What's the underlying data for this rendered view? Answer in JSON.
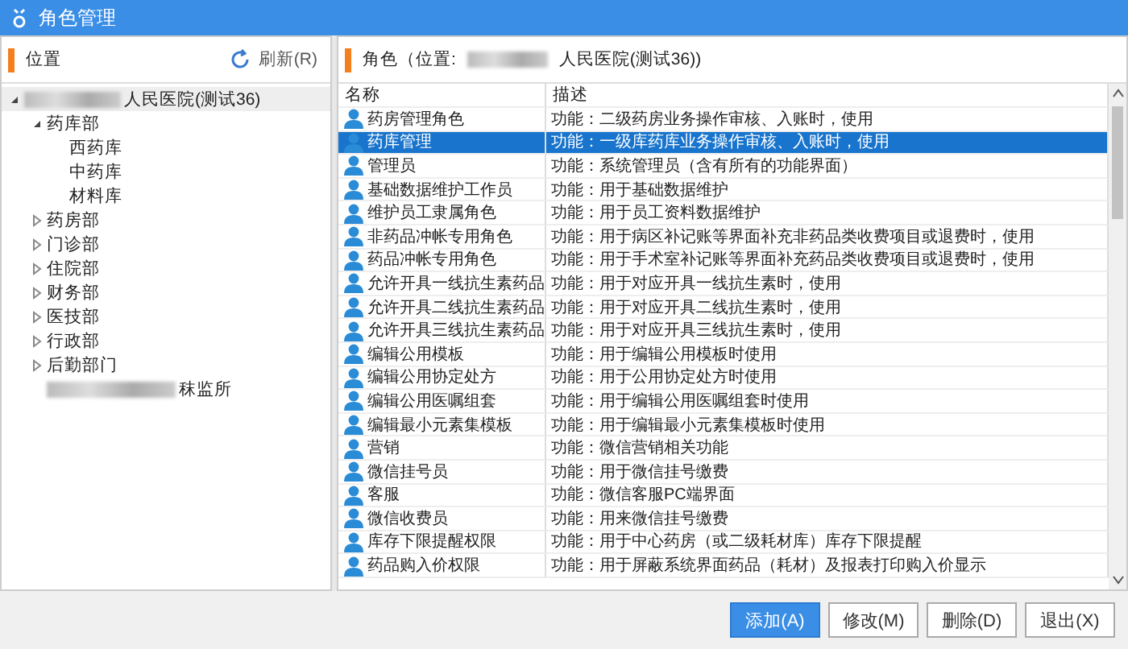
{
  "window": {
    "title": "角色管理"
  },
  "location_panel": {
    "title": "位置",
    "refresh_button": "刷新(R)",
    "tree": [
      {
        "label": "人民医院(测试36)",
        "redacted": true,
        "expanded": true,
        "children": [
          {
            "label": "药库部",
            "expanded": true,
            "children": [
              {
                "label": "西药库"
              },
              {
                "label": "中药库"
              },
              {
                "label": "材料库"
              }
            ]
          },
          {
            "label": "药房部",
            "expanded": false
          },
          {
            "label": "门诊部",
            "expanded": false
          },
          {
            "label": "住院部",
            "expanded": false
          },
          {
            "label": "财务部",
            "expanded": false
          },
          {
            "label": "医技部",
            "expanded": false
          },
          {
            "label": "行政部",
            "expanded": false
          },
          {
            "label": "后勤部门",
            "expanded": false
          },
          {
            "label": "秣监所",
            "redacted": true
          }
        ]
      }
    ]
  },
  "roles_panel": {
    "title_prefix": "角色（位置:",
    "title_suffix": "人民医院(测试36))",
    "table": {
      "columns": [
        "名称",
        "描述"
      ],
      "rows": [
        {
          "name": "药房管理角色",
          "description": "功能：二级药房业务操作审核、入账时，使用",
          "selected": false
        },
        {
          "name": "药库管理",
          "description": "功能：一级库药库业务操作审核、入账时，使用",
          "selected": true
        },
        {
          "name": "管理员",
          "description": "功能：系统管理员（含有所有的功能界面）",
          "selected": false
        },
        {
          "name": "基础数据维护工作员",
          "description": "功能：用于基础数据维护",
          "selected": false
        },
        {
          "name": "维护员工隶属角色",
          "description": "功能：用于员工资料数据维护",
          "selected": false
        },
        {
          "name": "非药品冲帐专用角色",
          "description": "功能：用于病区补记账等界面补充非药品类收费项目或退费时，使用",
          "selected": false
        },
        {
          "name": "药品冲帐专用角色",
          "description": "功能：用于手术室补记账等界面补充药品类收费项目或退费时，使用",
          "selected": false
        },
        {
          "name": "允许开具一线抗生素药品",
          "description": "功能：用于对应开具一线抗生素时，使用",
          "selected": false
        },
        {
          "name": "允许开具二线抗生素药品",
          "description": "功能：用于对应开具二线抗生素时，使用",
          "selected": false
        },
        {
          "name": "允许开具三线抗生素药品",
          "description": "功能：用于对应开具三线抗生素时，使用",
          "selected": false
        },
        {
          "name": "编辑公用模板",
          "description": "功能：用于编辑公用模板时使用",
          "selected": false
        },
        {
          "name": "编辑公用协定处方",
          "description": "功能：用于公用协定处方时使用",
          "selected": false
        },
        {
          "name": "编辑公用医嘱组套",
          "description": "功能：用于编辑公用医嘱组套时使用",
          "selected": false
        },
        {
          "name": "编辑最小元素集模板",
          "description": "功能：用于编辑最小元素集模板时使用",
          "selected": false
        },
        {
          "name": "营销",
          "description": "功能：微信营销相关功能",
          "selected": false
        },
        {
          "name": "微信挂号员",
          "description": "功能：用于微信挂号缴费",
          "selected": false
        },
        {
          "name": "客服",
          "description": "功能：微信客服PC端界面",
          "selected": false
        },
        {
          "name": "微信收费员",
          "description": "功能：用来微信挂号缴费",
          "selected": false
        },
        {
          "name": "库存下限提醒权限",
          "description": "功能：用于中心药房（或二级耗材库）库存下限提醒",
          "selected": false
        },
        {
          "name": "药品购入价权限",
          "description": "功能：用于屏蔽系统界面药品（耗材）及报表打印购入价显示",
          "selected": false
        }
      ]
    }
  },
  "buttons": [
    {
      "label": "添加(A)",
      "primary": true
    },
    {
      "label": "修改(M)",
      "primary": false
    },
    {
      "label": "删除(D)",
      "primary": false
    },
    {
      "label": "退出(X)",
      "primary": false
    }
  ]
}
